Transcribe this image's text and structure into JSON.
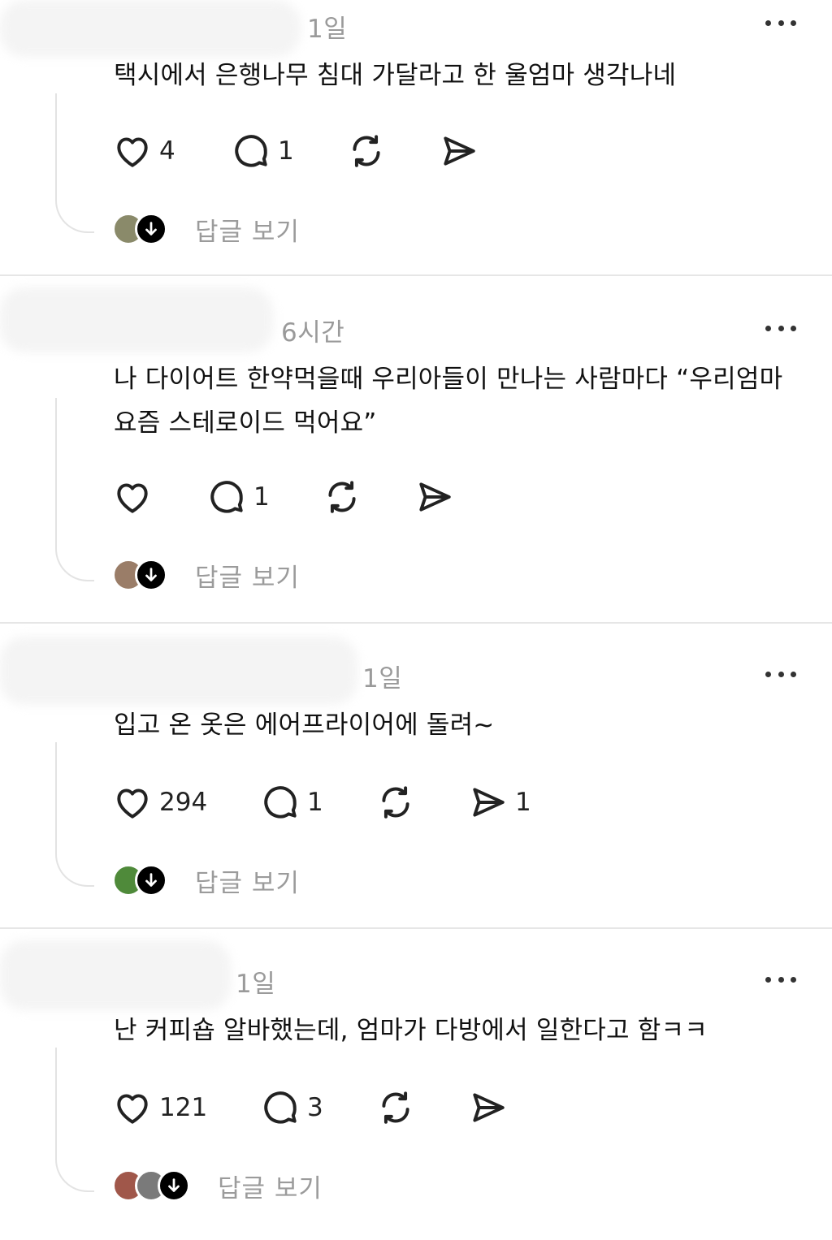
{
  "posts": [
    {
      "time": "1일",
      "text": "택시에서 은행나무 침대 가달라고 한 울엄마 생각나네",
      "likes": "4",
      "comments": "1",
      "shares": "",
      "reply_label": "답글 보기",
      "avatar_colors": [
        "#8a8a6a"
      ]
    },
    {
      "time": "6시간",
      "text": "나 다이어트 한약먹을때 우리아들이 만나는 사람마다 “우리엄마 요즘 스테로이드 먹어요”",
      "likes": "",
      "comments": "1",
      "shares": "",
      "reply_label": "답글 보기",
      "avatar_colors": [
        "#9a7d68"
      ]
    },
    {
      "time": "1일",
      "text": "입고 온 옷은 에어프라이어에 돌려~",
      "likes": "294",
      "comments": "1",
      "shares": "1",
      "reply_label": "답글 보기",
      "avatar_colors": [
        "#4f8a3a"
      ]
    },
    {
      "time": "1일",
      "text": "난 커피숍 알바했는데, 엄마가 다방에서 일한다고 함ㅋㅋ",
      "likes": "121",
      "comments": "3",
      "shares": "",
      "reply_label": "답글 보기",
      "avatar_colors": [
        "#a0574a",
        "#7a7a7a"
      ]
    }
  ],
  "icons": {
    "like": "heart-icon",
    "comment": "comment-bubble-icon",
    "repost": "repost-icon",
    "share": "send-icon",
    "more": "more-horizontal-icon",
    "reply_avatar": "download-arrow-icon"
  }
}
